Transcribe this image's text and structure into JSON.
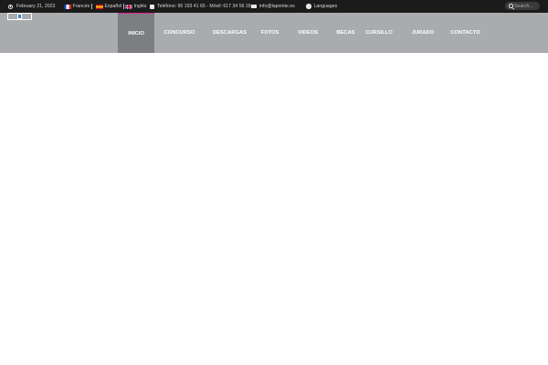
{
  "topbar": {
    "date": "February 21, 2023",
    "languages": [
      {
        "label": "Francés",
        "flag": "france-flag-icon"
      },
      {
        "label": "Español",
        "flag": "spain-flag-icon"
      },
      {
        "label": "Inglés",
        "flag": "uk-flag-icon"
      }
    ],
    "phone": "Teléfono: 96 193 41 65 - Móvil: 617 34 56 18",
    "email": "info@lapointe.es",
    "languages_label": "Languages",
    "search_placeholder": "Search..."
  },
  "nav": {
    "items": [
      {
        "label": "INICIO",
        "active": true
      },
      {
        "label": "CONCURSO",
        "active": false
      },
      {
        "label": "DESCARGAS",
        "active": false
      },
      {
        "label": "FOTOS",
        "active": false
      },
      {
        "label": "VIDEOS",
        "active": false
      },
      {
        "label": "BECAS",
        "active": false
      },
      {
        "label": "CURSILLO",
        "active": false
      },
      {
        "label": "JURADO",
        "active": false
      },
      {
        "label": "CONTACTO",
        "active": false
      }
    ]
  },
  "colors": {
    "topbar_bg": "#1b1b1b",
    "nav_bg": "#a9abae",
    "nav_active_bg": "#7c7e82",
    "nav_active_accent": "#e0299a"
  }
}
